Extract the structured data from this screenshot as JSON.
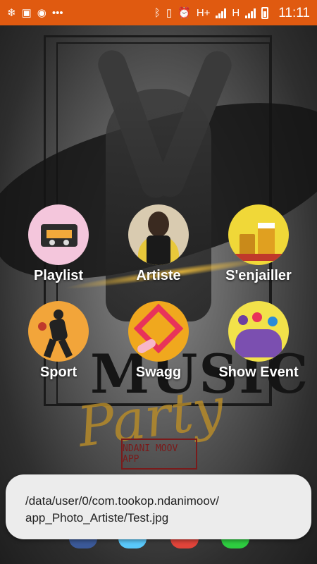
{
  "status_bar": {
    "time": "11:11",
    "network_1": "H+",
    "network_2": "H",
    "icons_left": [
      "snowflake-icon",
      "gallery-icon",
      "chrome-icon",
      "more-icon"
    ],
    "icons_right": [
      "bluetooth-icon",
      "vibrate-icon",
      "alarm-icon",
      "signal-icon",
      "signal-icon",
      "battery-icon"
    ],
    "color": "#e05a10"
  },
  "poster": {
    "stamp_text": "NDANI MOOV APP",
    "music_word": "MUSIC",
    "party_word": "Party"
  },
  "menu": {
    "items": [
      {
        "label": "Playlist"
      },
      {
        "label": "Artiste"
      },
      {
        "label": "S'enjailler"
      },
      {
        "label": "Sport"
      },
      {
        "label": "Swagg"
      },
      {
        "label": "Show Event"
      }
    ]
  },
  "toast": {
    "line1": "/data/user/0/com.tookop.ndanimoov/",
    "line2": "app_Photo_Artiste/Test.jpg"
  }
}
